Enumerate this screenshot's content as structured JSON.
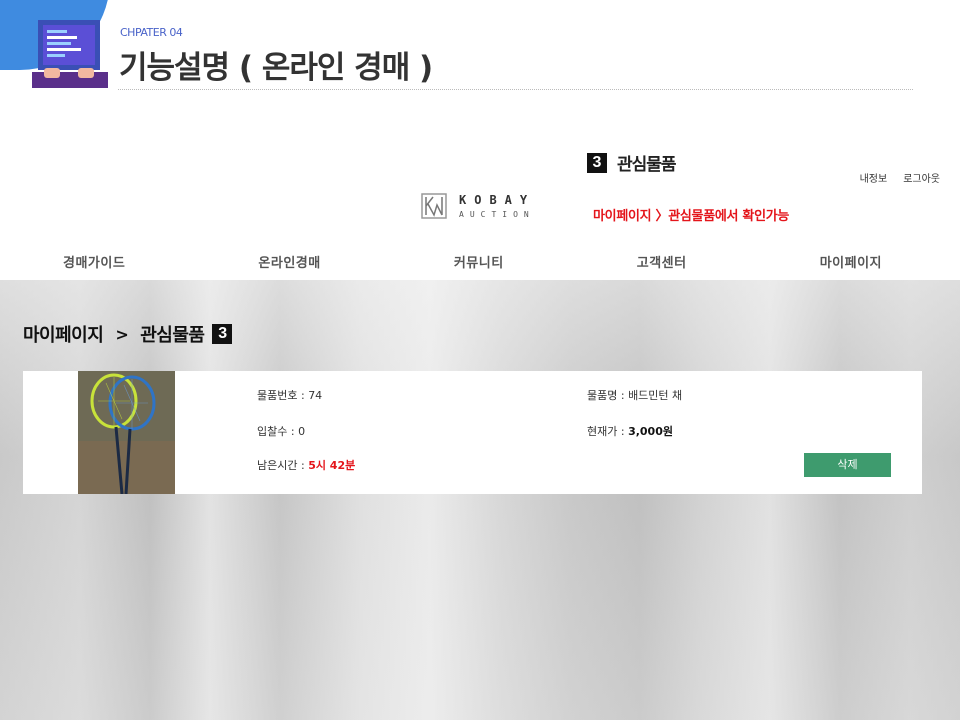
{
  "slide": {
    "chapter": "CHPATER 04",
    "title": "기능설명 ( 온라인 경매 )"
  },
  "annotation": {
    "badge": "3",
    "heading": "관심물품",
    "note": "마이페이지 〉관심물품에서 확인가능"
  },
  "site": {
    "user_links": [
      "내정보",
      "로그아웃"
    ],
    "logo": {
      "main": "KOBAY",
      "sub": "AUCTION"
    },
    "nav": [
      "경매가이드",
      "온라인경매",
      "커뮤니티",
      "고객센터",
      "마이페이지"
    ]
  },
  "breadcrumb": {
    "parent": "마이페이지",
    "separator": ">",
    "current": "관심물품",
    "badge": "3"
  },
  "item": {
    "number_label": "물품번호 : ",
    "number_value": "74",
    "name_label": "물품명 : ",
    "name_value": "배드민턴 채",
    "bids_label": "입찰수 : ",
    "bids_value": "0",
    "price_label": "현재가 : ",
    "price_value": "3,000원",
    "time_label": "남은시간 : ",
    "time_value": "5시 42분",
    "delete_label": "삭제"
  },
  "colors": {
    "accent_red": "#e4151b",
    "delete_green": "#3e9b6e",
    "corner_blue": "#3f8be0"
  }
}
